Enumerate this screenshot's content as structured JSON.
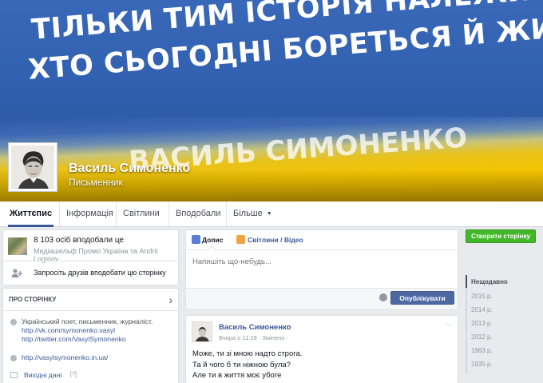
{
  "cover": {
    "slogan_line1": "ТІЛЬКИ ТИМ ІСТОРІЯ НАЛЕЖИТЬ,",
    "slogan_line2": "ХТО СЬОГОДНІ БОРЕТЬСЯ Й ЖИВЕ.",
    "watermark": "ВАСИЛЬ СИМОНЕНКО",
    "colors": {
      "blue": "#3465b3",
      "yellow": "#f3c400"
    }
  },
  "page": {
    "name": "Василь Симоненко",
    "category": "Письменник"
  },
  "nav": {
    "tabs": [
      "Життєпис",
      "Інформація",
      "Світлини",
      "Вподобали",
      "Більше"
    ],
    "active": "Життєпис"
  },
  "likes": {
    "count_text": "8 103 осіб вподобали це",
    "friends_text": "Медіашельф Промо Україна та Andrii Loginov",
    "invite_text": "Запросіть друзів вподобати цю сторінку"
  },
  "about": {
    "title": "ПРО СТОРІНКУ",
    "description": "Український поет, письменник, журналіст.",
    "links": [
      "http://vk.com/symonenko.vasyl",
      "http://twitter.com/VasylSymonenko"
    ],
    "website": "http://vasylsymonenko.in.ua/",
    "hours_label": "Вихідні дані",
    "hours_badge": "[?]"
  },
  "composer": {
    "tab_post": "Допис",
    "tab_photo": "Світлини / Відео",
    "placeholder": "Напишіть що-небудь...",
    "publish_label": "Опублікувати"
  },
  "post": {
    "author": "Василь Симоненко",
    "meta": "Вчора о 11:28 · Змінено ·",
    "lines": [
      "Може, ти зі мною надто строга.",
      "Та й чого б ти ніжною була?",
      "Але ти в життя моє убоге"
    ]
  },
  "sidebar_right": {
    "create_page_label": "Створити сторінку",
    "timeline": [
      "Нещодавно",
      "2015 р.",
      "2014 р.",
      "2013 р.",
      "2012 р.",
      "1963 р.",
      "1935 р."
    ]
  },
  "accent_color": "#3b5998"
}
